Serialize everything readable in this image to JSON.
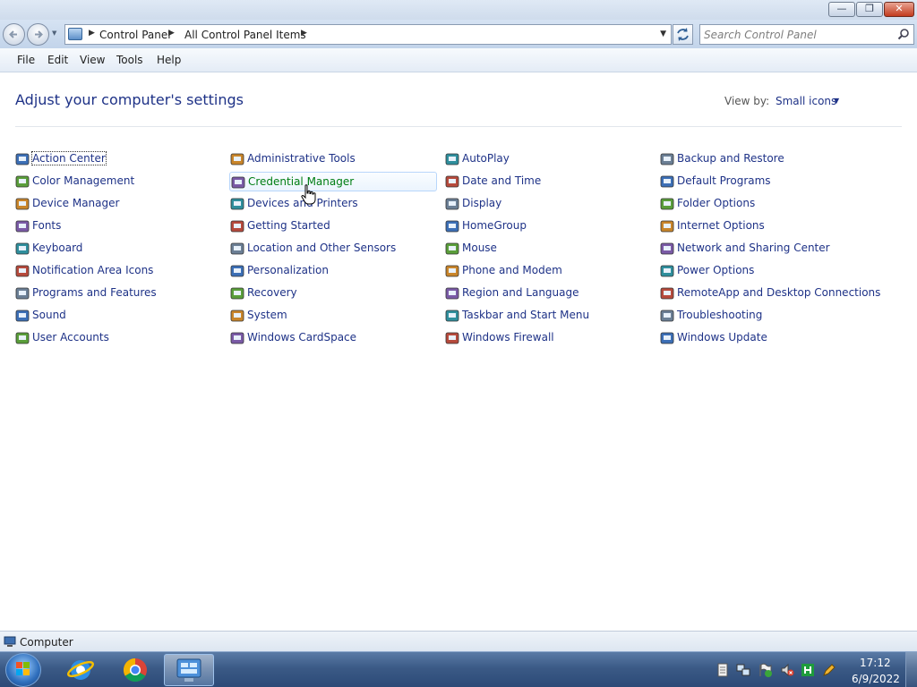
{
  "window": {
    "buttons": {
      "minimize": "—",
      "maximize": "❐",
      "close": "✕"
    }
  },
  "address": {
    "breadcrumb": [
      "Control Panel",
      "All Control Panel Items"
    ],
    "search_placeholder": "Search Control Panel"
  },
  "menu": [
    "File",
    "Edit",
    "View",
    "Tools",
    "Help"
  ],
  "content": {
    "heading": "Adjust your computer's settings",
    "view_by_label": "View by:",
    "view_by_value": "Small icons",
    "columns": [
      [
        {
          "label": "Action Center",
          "icon": "flag-icon"
        },
        {
          "label": "Color Management",
          "icon": "monitor-color-icon"
        },
        {
          "label": "Device Manager",
          "icon": "printer-device-icon"
        },
        {
          "label": "Fonts",
          "icon": "folder-fonts-icon"
        },
        {
          "label": "Keyboard",
          "icon": "keyboard-icon"
        },
        {
          "label": "Notification Area Icons",
          "icon": "tray-icon"
        },
        {
          "label": "Programs and Features",
          "icon": "programs-icon"
        },
        {
          "label": "Sound",
          "icon": "speaker-icon"
        },
        {
          "label": "User Accounts",
          "icon": "users-icon"
        }
      ],
      [
        {
          "label": "Administrative Tools",
          "icon": "admin-tools-icon"
        },
        {
          "label": "Credential Manager",
          "icon": "vault-icon"
        },
        {
          "label": "Devices and Printers",
          "icon": "printer-icon"
        },
        {
          "label": "Getting Started",
          "icon": "getting-started-icon"
        },
        {
          "label": "Location and Other Sensors",
          "icon": "sensor-icon"
        },
        {
          "label": "Personalization",
          "icon": "personalization-icon"
        },
        {
          "label": "Recovery",
          "icon": "recovery-icon"
        },
        {
          "label": "System",
          "icon": "system-icon"
        },
        {
          "label": "Windows CardSpace",
          "icon": "cardspace-icon"
        }
      ],
      [
        {
          "label": "AutoPlay",
          "icon": "autoplay-icon"
        },
        {
          "label": "Date and Time",
          "icon": "clock-icon"
        },
        {
          "label": "Display",
          "icon": "display-icon"
        },
        {
          "label": "HomeGroup",
          "icon": "homegroup-icon"
        },
        {
          "label": "Mouse",
          "icon": "mouse-icon"
        },
        {
          "label": "Phone and Modem",
          "icon": "phone-icon"
        },
        {
          "label": "Region and Language",
          "icon": "globe-icon"
        },
        {
          "label": "Taskbar and Start Menu",
          "icon": "taskbar-icon"
        },
        {
          "label": "Windows Firewall",
          "icon": "firewall-icon"
        }
      ],
      [
        {
          "label": "Backup and Restore",
          "icon": "backup-icon"
        },
        {
          "label": "Default Programs",
          "icon": "default-programs-icon"
        },
        {
          "label": "Folder Options",
          "icon": "folder-icon"
        },
        {
          "label": "Internet Options",
          "icon": "internet-icon"
        },
        {
          "label": "Network and Sharing Center",
          "icon": "network-icon"
        },
        {
          "label": "Power Options",
          "icon": "power-icon"
        },
        {
          "label": "RemoteApp and Desktop Connections",
          "icon": "remote-icon"
        },
        {
          "label": "Troubleshooting",
          "icon": "troubleshoot-icon"
        },
        {
          "label": "Windows Update",
          "icon": "update-icon"
        }
      ]
    ],
    "focused_item": "Action Center",
    "hovered_item": "Credential Manager"
  },
  "status": {
    "text": "Computer"
  },
  "taskbar": {
    "pinned": [
      "internet-explorer-icon",
      "chrome-icon",
      "control-panel-icon"
    ],
    "time": "17:12",
    "date": "6/9/2022"
  },
  "colors": {
    "link": "#1e3287",
    "hover_link": "#007d13",
    "taskbar": "#3b5a86"
  }
}
